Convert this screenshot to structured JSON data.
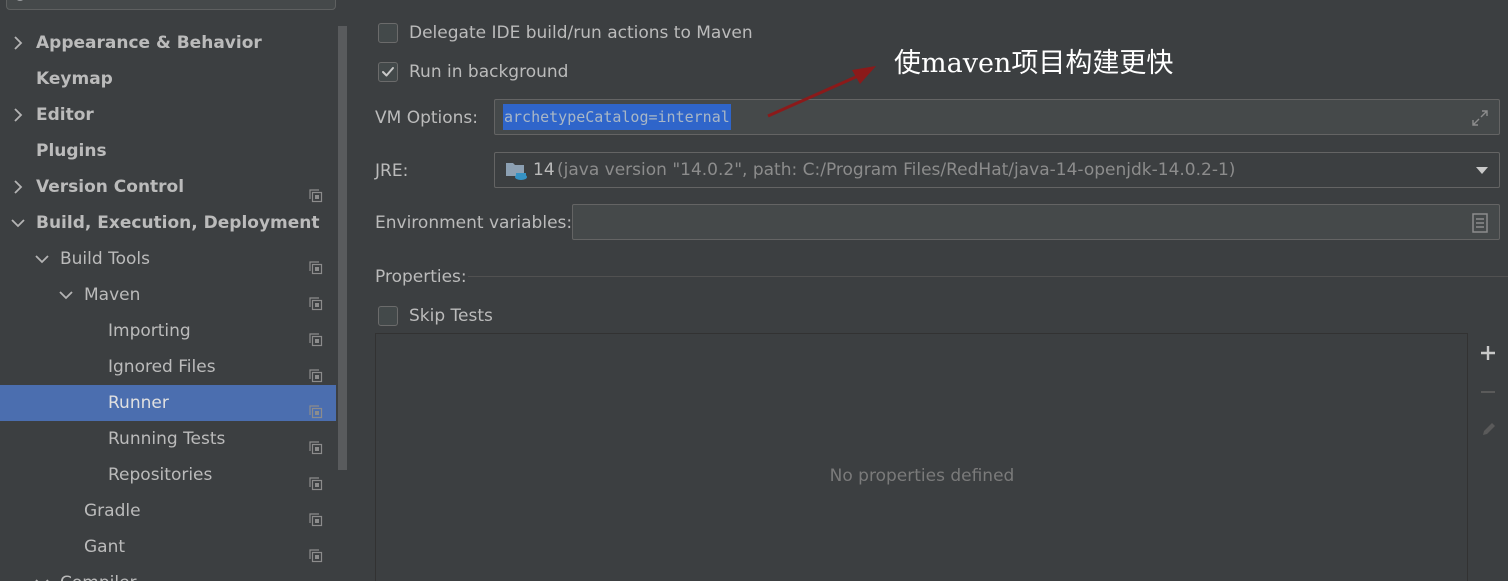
{
  "sidebar": {
    "items": [
      {
        "label": "Appearance & Behavior",
        "bold": true,
        "indent": 0,
        "arrow": "right",
        "copy": false,
        "selected": false
      },
      {
        "label": "Keymap",
        "bold": true,
        "indent": 0,
        "arrow": "none",
        "copy": false,
        "selected": false
      },
      {
        "label": "Editor",
        "bold": true,
        "indent": 0,
        "arrow": "right",
        "copy": false,
        "selected": false
      },
      {
        "label": "Plugins",
        "bold": true,
        "indent": 0,
        "arrow": "none",
        "copy": false,
        "selected": false
      },
      {
        "label": "Version Control",
        "bold": true,
        "indent": 0,
        "arrow": "right",
        "copy": true,
        "selected": false
      },
      {
        "label": "Build, Execution, Deployment",
        "bold": true,
        "indent": 0,
        "arrow": "down",
        "copy": false,
        "selected": false
      },
      {
        "label": "Build Tools",
        "bold": false,
        "indent": 1,
        "arrow": "down",
        "copy": true,
        "selected": false
      },
      {
        "label": "Maven",
        "bold": false,
        "indent": 2,
        "arrow": "down",
        "copy": true,
        "selected": false
      },
      {
        "label": "Importing",
        "bold": false,
        "indent": 3,
        "arrow": "none",
        "copy": true,
        "selected": false
      },
      {
        "label": "Ignored Files",
        "bold": false,
        "indent": 3,
        "arrow": "none",
        "copy": true,
        "selected": false
      },
      {
        "label": "Runner",
        "bold": false,
        "indent": 3,
        "arrow": "none",
        "copy": true,
        "selected": true
      },
      {
        "label": "Running Tests",
        "bold": false,
        "indent": 3,
        "arrow": "none",
        "copy": true,
        "selected": false
      },
      {
        "label": "Repositories",
        "bold": false,
        "indent": 3,
        "arrow": "none",
        "copy": true,
        "selected": false
      },
      {
        "label": "Gradle",
        "bold": false,
        "indent": 2,
        "arrow": "none",
        "copy": true,
        "selected": false
      },
      {
        "label": "Gant",
        "bold": false,
        "indent": 2,
        "arrow": "none",
        "copy": true,
        "selected": false
      },
      {
        "label": "Compiler",
        "bold": false,
        "indent": 1,
        "arrow": "down",
        "copy": true,
        "selected": false
      }
    ]
  },
  "runner": {
    "delegate_label": "Delegate IDE build/run actions to Maven",
    "delegate_checked": false,
    "background_label": "Run in background",
    "background_checked": true,
    "vm_options_label": "VM Options:",
    "vm_options_value": "archetypeCatalog=internal",
    "jre_label": "JRE:",
    "jre_version": "14",
    "jre_details": "(java version \"14.0.2\", path: C:/Program Files/RedHat/java-14-openjdk-14.0.2-1)",
    "env_label": "Environment variables:",
    "env_value": "",
    "properties_label": "Properties:",
    "skip_tests_label": "Skip Tests",
    "skip_tests_checked": false,
    "properties_empty_text": "No properties defined"
  },
  "annotation": {
    "text": "使maven项目构建更快",
    "color": "#8b1a1a"
  },
  "colors": {
    "background": "#3c3f41",
    "selection": "#4b6eaf",
    "text_selection": "#2f65ca"
  },
  "icons": [
    "search-icon",
    "chevron-right-icon",
    "chevron-down-icon",
    "copy-settings-icon",
    "expand-icon",
    "folder-java-icon",
    "dropdown-arrow-icon",
    "browse-list-icon",
    "add-icon",
    "remove-icon",
    "edit-icon"
  ]
}
